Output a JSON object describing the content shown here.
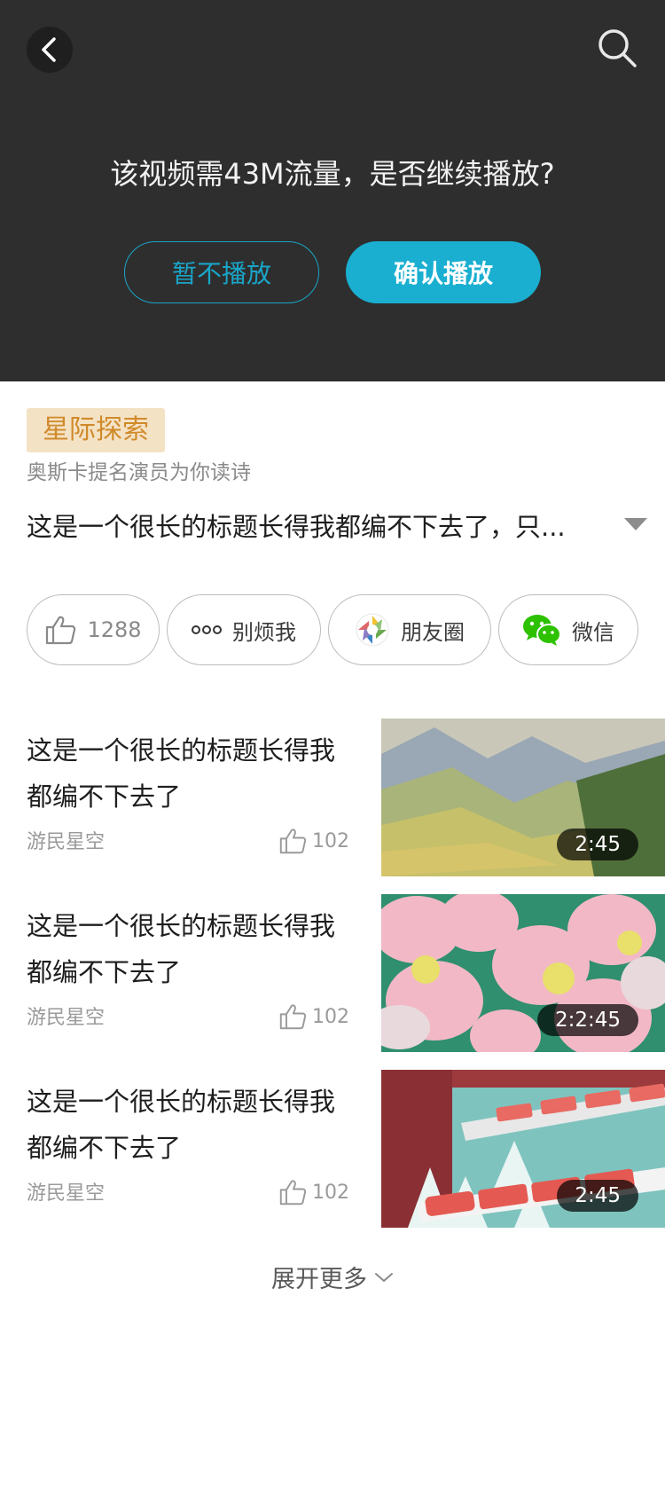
{
  "player": {
    "prompt": "该视频需43M流量，是否继续播放?",
    "cancel_label": "暂不播放",
    "confirm_label": "确认播放"
  },
  "info": {
    "tag": "星际探索",
    "subtitle": "奥斯卡提名演员为你读诗",
    "title": "这是一个很长的标题长得我都编不下去了，只..."
  },
  "actions": {
    "like_count": "1288",
    "dnd_label": "别烦我",
    "moments_label": "朋友圈",
    "wechat_label": "微信"
  },
  "list": [
    {
      "title": "这是一个很长的标题长得我都编不下去了",
      "author": "游民星空",
      "likes": "102",
      "duration": "2:45"
    },
    {
      "title": "这是一个很长的标题长得我都编不下去了",
      "author": "游民星空",
      "likes": "102",
      "duration": "2:2:45"
    },
    {
      "title": "这是一个很长的标题长得我都编不下去了",
      "author": "游民星空",
      "likes": "102",
      "duration": "2:45"
    }
  ],
  "more_label": "展开更多",
  "colors": {
    "accent": "#1aafd0",
    "tag_bg": "#f4e2c5",
    "tag_text": "#d08a2a",
    "player_bg": "#2e2e2e"
  }
}
